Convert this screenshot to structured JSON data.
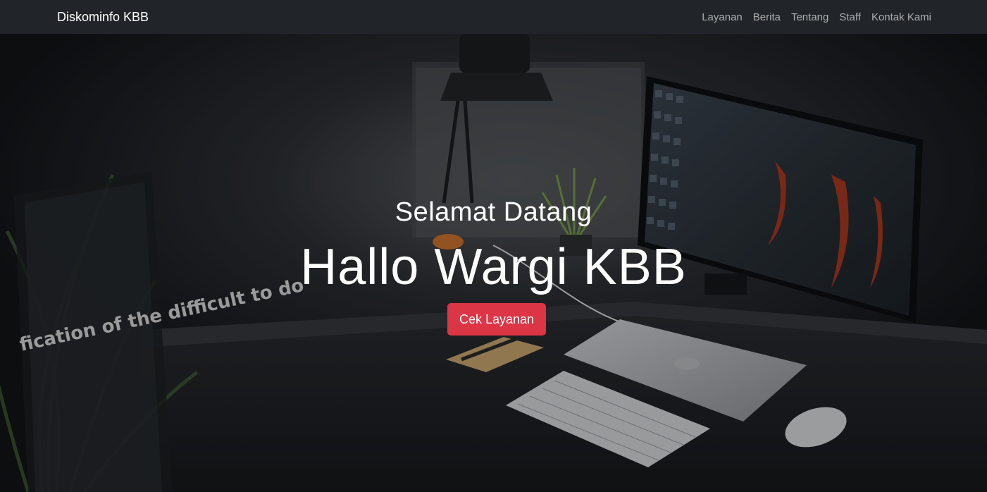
{
  "brand": "Diskominfo KBB",
  "nav": {
    "items": [
      {
        "label": "Layanan"
      },
      {
        "label": "Berita"
      },
      {
        "label": "Tentang"
      },
      {
        "label": "Staff"
      },
      {
        "label": "Kontak Kami"
      }
    ]
  },
  "hero": {
    "subtitle": "Selamat Datang",
    "title": "Hallo Wargi KBB",
    "button_label": "Cek Layanan",
    "button_color": "#dc3545",
    "poster_text": "fication of the difficult to do"
  },
  "colors": {
    "navbar_bg": "#212529",
    "accent": "#dc3545"
  }
}
